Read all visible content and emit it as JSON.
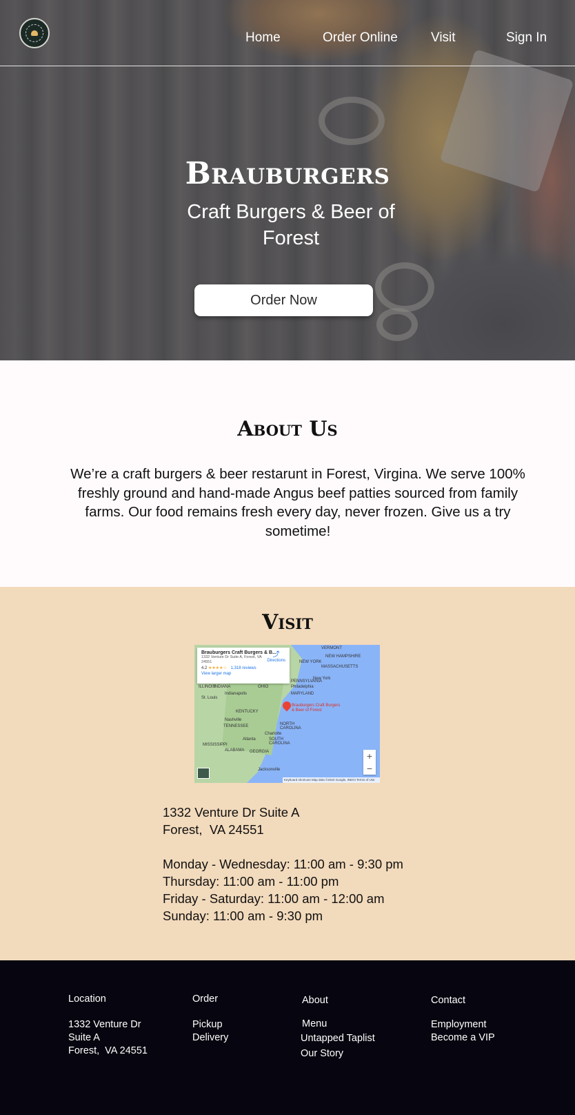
{
  "nav": {
    "links": [
      {
        "label": "Home"
      },
      {
        "label": "Order Online"
      },
      {
        "label": "Visit"
      },
      {
        "label": "Sign In"
      }
    ]
  },
  "hero": {
    "title": "Brauburgers",
    "subtitle": "Craft Burgers & Beer of Forest",
    "cta_label": "Order Now"
  },
  "about": {
    "title": "About Us",
    "text": "We’re a craft burgers & beer restarunt in Forest, Virgina. We serve 100% freshly ground and hand-made Angus beef patties sourced from family farms. Our food remains fresh every day, never frozen. Give us a try sometime!"
  },
  "visit": {
    "title": "Visit",
    "map": {
      "place_name": "Brauburgers Craft Burgers & B...",
      "place_address": "1332 Venture Dr Suite A, Forest, VA 24551",
      "rating": "4.2",
      "stars": "★★★★☆",
      "reviews": "1,318 reviews",
      "larger_map": "View larger map",
      "directions": "Directions",
      "pin_label": "Brauburgers Craft Burgers & Beer of Forest",
      "labels": {
        "vermont": "VERMONT",
        "new_hampshire": "NEW HAMPSHIRE",
        "new_york_state": "NEW YORK",
        "massachusetts": "MASSACHUSETTS",
        "new_york": "New York",
        "indiana": "INDIANA",
        "ohio": "OHIO",
        "pennsylvania": "PENNSYLVANIA",
        "philadelphia": "Philadelphia",
        "illinois": "ILLINOIS",
        "indianapolis": "Indianapolis",
        "maryland": "MARYLAND",
        "st_louis": "St. Louis",
        "kentucky": "KENTUCKY",
        "nashville": "Nashville",
        "tennessee": "TENNESSEE",
        "north_carolina": "NORTH CAROLINA",
        "charlotte": "Charlotte",
        "atlanta": "Atlanta",
        "south_carolina": "SOUTH CAROLINA",
        "mississippi": "MISSISSIPPI",
        "alabama": "ALABAMA",
        "georgia": "GEORGIA",
        "jacksonville": "Jacksonville"
      },
      "zoom_in": "+",
      "zoom_out": "−",
      "footer": "Keyboard shortcuts   Map data ©2022 Google, INEGI   Terms of Use"
    },
    "address_line1": "1332 Venture Dr Suite A",
    "address_line2": "Forest,  VA 24551",
    "hours": [
      "Monday - Wednesday: 11:00 am - 9:30 pm",
      "Thursday: 11:00 am - 11:00 pm",
      "Friday - Saturday: 11:00 am - 12:00 am",
      "Sunday: 11:00 am - 9:30 pm"
    ]
  },
  "footer": {
    "location": {
      "heading": "Location",
      "lines": [
        "1332 Venture Dr",
        "Suite A",
        "Forest,  VA 24551"
      ]
    },
    "order": {
      "heading": "Order",
      "items": [
        "Pickup",
        "Delivery"
      ]
    },
    "about": {
      "heading": "About",
      "items": [
        "Menu",
        "Untapped Taplist",
        "Our Story"
      ]
    },
    "contact": {
      "heading": "Contact",
      "items": [
        "Employment",
        "Become a VIP"
      ]
    }
  }
}
